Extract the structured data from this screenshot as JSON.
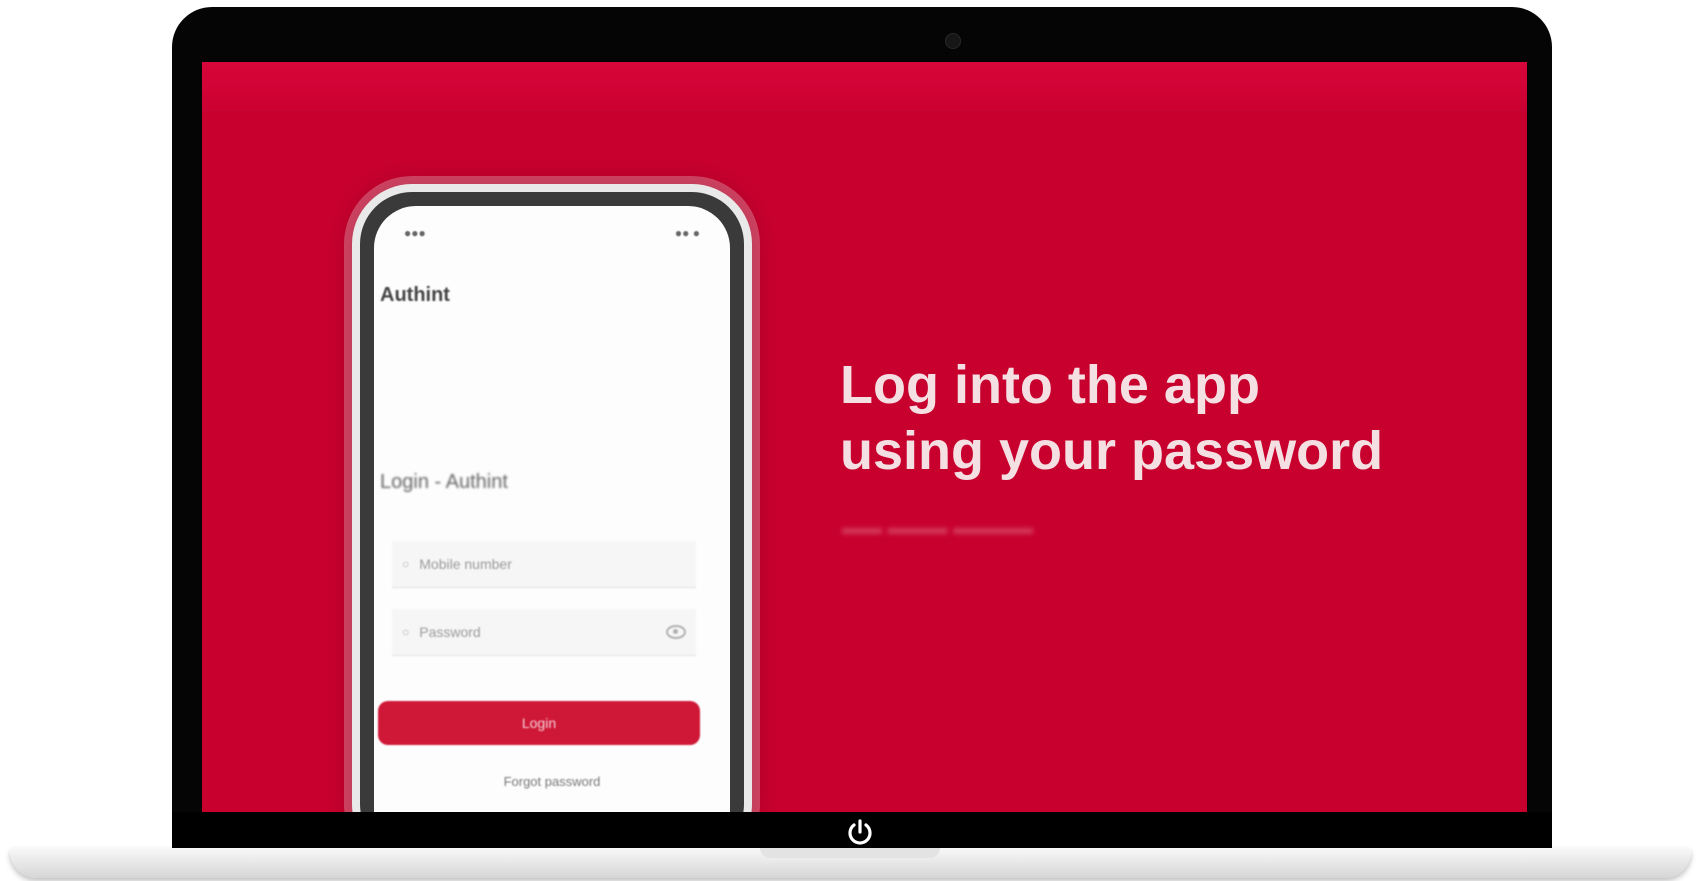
{
  "screen": {
    "headline_line1": "Log into the app",
    "headline_line2": "using your password",
    "accent_color": "#c8002e"
  },
  "phone": {
    "title": "Authint",
    "login_heading": "Login - Authint",
    "username_placeholder": "Mobile number",
    "password_placeholder": "Password",
    "login_button": "Login",
    "link_text": "Forgot password"
  },
  "icons": {
    "power": "power-icon",
    "eye": "eye-icon",
    "camera": "camera-icon"
  }
}
